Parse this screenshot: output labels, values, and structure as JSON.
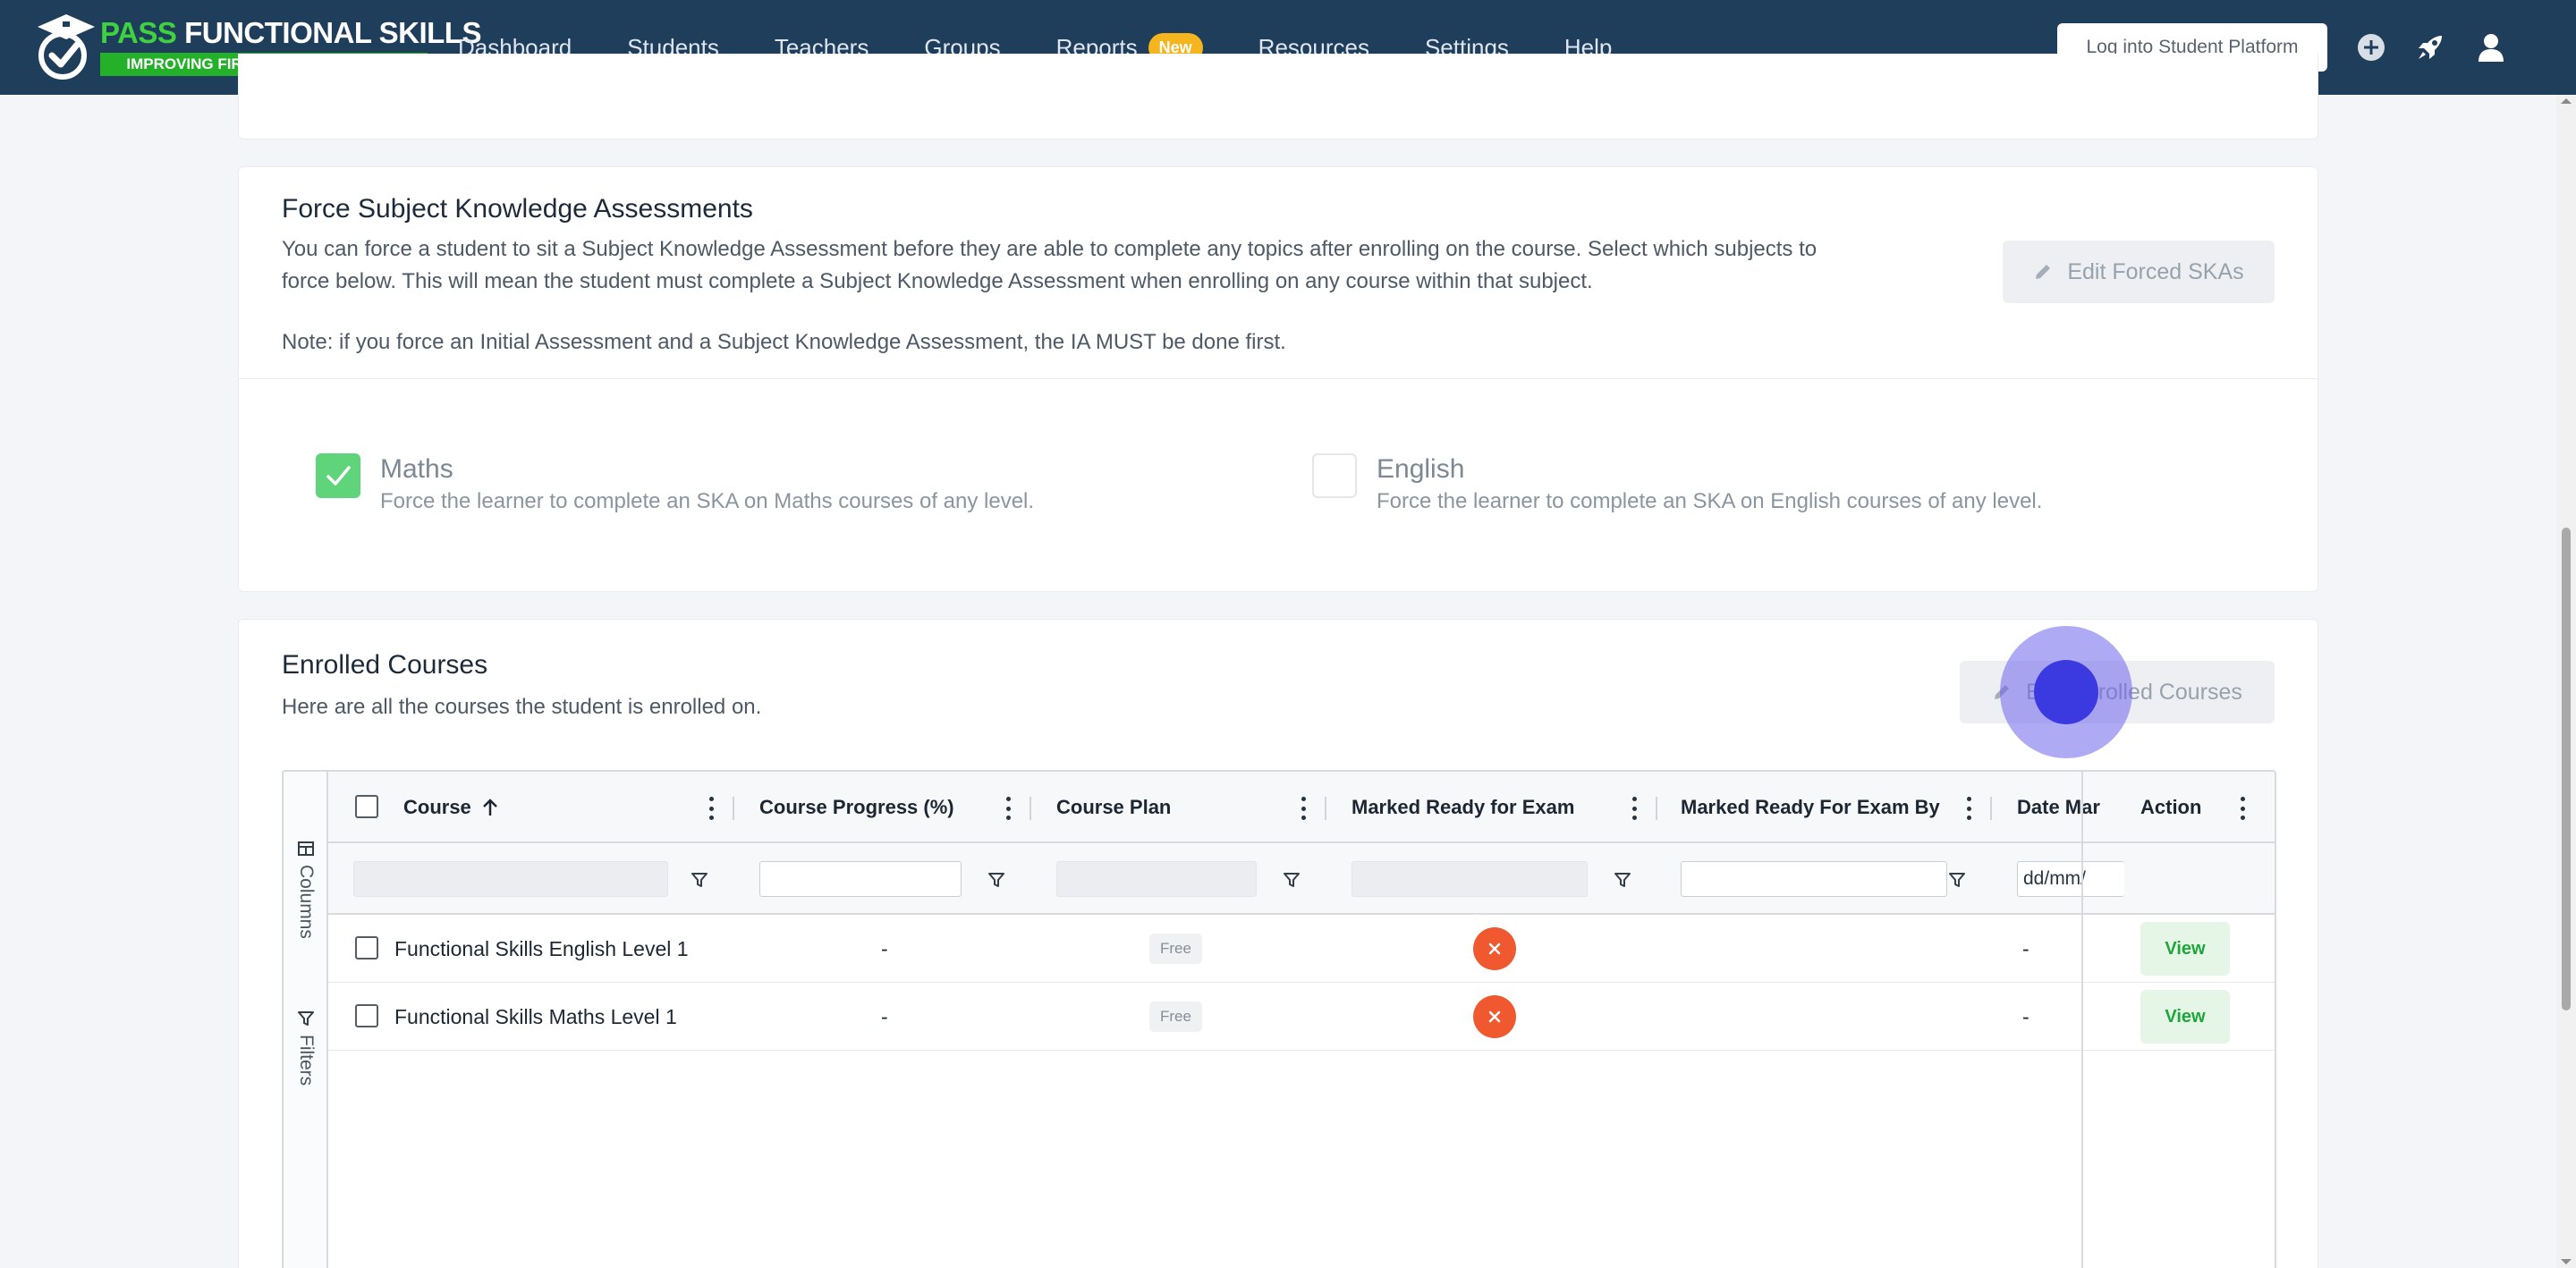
{
  "brand": {
    "title_pass": "PASS",
    "title_rest": "FUNCTIONAL SKILLS",
    "tagline": "IMPROVING FIRST TIME PASS RATES"
  },
  "nav": {
    "items": [
      {
        "label": "Dashboard"
      },
      {
        "label": "Students"
      },
      {
        "label": "Teachers"
      },
      {
        "label": "Groups"
      },
      {
        "label": "Reports",
        "badge": "New"
      },
      {
        "label": "Resources"
      },
      {
        "label": "Settings"
      },
      {
        "label": "Help"
      }
    ],
    "login_button": "Log into Student Platform",
    "icons": [
      "plus-circle-icon",
      "rocket-icon",
      "user-icon"
    ]
  },
  "force_ska": {
    "title": "Force Subject Knowledge Assessments",
    "description_line1": "You can force a student to sit a Subject Knowledge Assessment before they are able to complete any topics after enrolling on the course. Select which subjects to",
    "description_line2": "force below. This will mean the student must complete a Subject Knowledge Assessment when enrolling on any course within that subject.",
    "note": "Note: if you force an Initial Assessment and a Subject Knowledge Assessment, the IA MUST be done first.",
    "edit_button": "Edit Forced SKAs",
    "subjects": [
      {
        "name": "Maths",
        "description": "Force the learner to complete an SKA on Maths courses of any level.",
        "checked": true
      },
      {
        "name": "English",
        "description": "Force the learner to complete an SKA on English courses of any level.",
        "checked": false
      }
    ]
  },
  "enrolled": {
    "title": "Enrolled Courses",
    "subtitle": "Here are all the courses the student is enrolled on.",
    "edit_button": "Edit Enrolled Courses",
    "side_tabs": [
      "Columns",
      "Filters"
    ],
    "columns": [
      "Course",
      "Course Progress (%)",
      "Course Plan",
      "Marked Ready for Exam",
      "Marked Ready For Exam By",
      "Date Mar",
      "Action"
    ],
    "date_placeholder": "dd/mm/",
    "rows": [
      {
        "course": "Functional Skills English Level 1",
        "progress": "-",
        "plan": "Free",
        "ready_by": "",
        "date": "-",
        "action": "View"
      },
      {
        "course": "Functional Skills Maths Level 1",
        "progress": "-",
        "plan": "Free",
        "ready_by": "",
        "date": "-",
        "action": "View"
      }
    ]
  },
  "colors": {
    "navbar": "#1f3e5c",
    "brand_green": "#3fd13f",
    "badge": "#f5b51e",
    "checked": "#5fd47a",
    "not_ready": "#f0582f",
    "view": "#1ea63c"
  }
}
